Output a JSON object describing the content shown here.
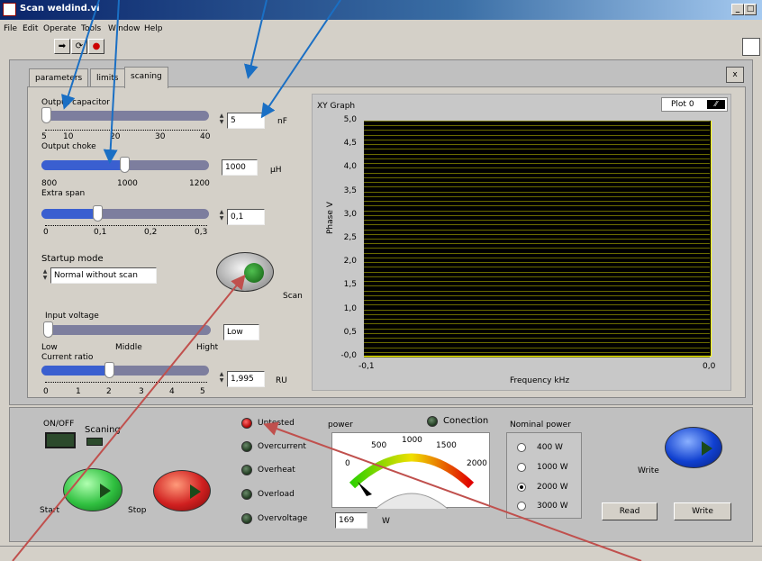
{
  "window": {
    "title": "Scan weldind.vi"
  },
  "menu": [
    "File",
    "Edit",
    "Operate",
    "Tools",
    "Window",
    "Help"
  ],
  "tabs": {
    "t1": "parameters",
    "t2": "limits",
    "t3": "scaning"
  },
  "close_x": "x",
  "cap": {
    "label": "Output capacitor",
    "ticks": [
      "5",
      "10",
      "20",
      "30",
      "40"
    ],
    "value": "5",
    "unit": "nF",
    "level": 0.0
  },
  "choke": {
    "label": "Output choke",
    "ticks": [
      "800",
      "1000",
      "1200"
    ],
    "value": "1000",
    "unit": "μH",
    "level": 0.5
  },
  "span": {
    "label": "Extra span",
    "ticks": [
      "0",
      "0,1",
      "0,2",
      "0,3"
    ],
    "value": "0,1",
    "level": 0.33
  },
  "startup": {
    "label": "Startup mode",
    "value": "Normal without scan",
    "scan": "Scan"
  },
  "voltage": {
    "label": "Input voltage",
    "ticks": [
      "Low",
      "Middle",
      "Hight"
    ],
    "value": "Low",
    "level": 0.0
  },
  "current": {
    "label": "Current ratio",
    "ticks": [
      "0",
      "1",
      "2",
      "3",
      "4",
      "5"
    ],
    "value": "1,995",
    "unit": "RU",
    "level": 0.4
  },
  "graph": {
    "title": "XY Graph",
    "plot": "Plot 0",
    "ylabel": "Phase V",
    "xlabel": "Frequency  kHz",
    "yticks": [
      "5,0",
      "4,5",
      "4,0",
      "3,5",
      "3,0",
      "2,5",
      "2,0",
      "1,5",
      "1,0",
      "0,5",
      "-0,0"
    ],
    "xmin": "-0,1",
    "xmax": "0,0"
  },
  "chart_data": {
    "type": "line",
    "title": "XY Graph",
    "xlabel": "Frequency  kHz",
    "ylabel": "Phase V",
    "xlim": [
      -0.1,
      0.0
    ],
    "ylim": [
      0,
      5
    ],
    "series": [
      {
        "name": "Plot 0",
        "x": [],
        "y": []
      }
    ]
  },
  "bottom": {
    "onoff": "ON/OFF",
    "scaning": "Scaning",
    "start": "Start",
    "stop": "Stop",
    "untested": "Untested",
    "overcurrent": "Overcurrent",
    "overheat": "Overheat",
    "overload": "Overload",
    "overvoltage": "Overvoltage",
    "conection": "Conection",
    "power": "power",
    "power_value": "169",
    "power_unit": "W",
    "gauge_ticks": [
      "0",
      "500",
      "1000",
      "1500",
      "2000"
    ],
    "nominal": "Nominal power",
    "options": [
      "400 W",
      "1000 W",
      "2000 W",
      "3000 W"
    ],
    "selected": "2000 W",
    "write_label": "Write",
    "read_btn": "Read",
    "write_btn": "Write"
  },
  "colors": {
    "blue_arrow": "#1a6fc4",
    "red_arrow": "#c0504d",
    "led_red": "#e00000",
    "green_btn": "#30c040",
    "red_btn": "#d02020",
    "blue_btn": "#1040d0"
  }
}
